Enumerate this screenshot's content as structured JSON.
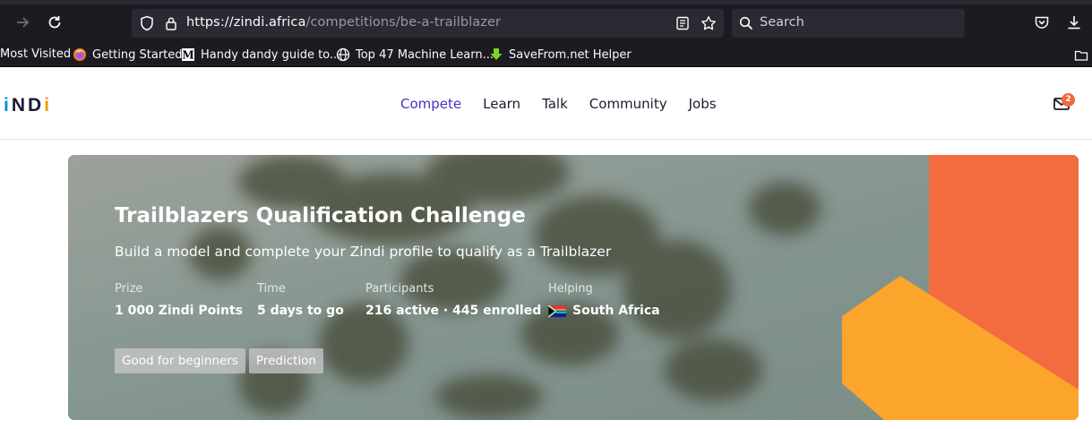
{
  "browser": {
    "url_domain": "https://zindi.africa",
    "url_path": "/competitions/be-a-trailblazer",
    "search_placeholder": "Search",
    "bookmarks": [
      {
        "label": "Most Visited",
        "icon": "none"
      },
      {
        "label": "Getting Started",
        "icon": "firefox-icon"
      },
      {
        "label": "Handy dandy guide to...",
        "icon": "medium-icon"
      },
      {
        "label": "Top 47 Machine Learn...",
        "icon": "globe-icon"
      },
      {
        "label": "SaveFrom.net Helper",
        "icon": "download-arrow-icon"
      }
    ]
  },
  "site": {
    "logo": "iNDi",
    "nav": [
      {
        "label": "Compete",
        "active": true
      },
      {
        "label": "Learn",
        "active": false
      },
      {
        "label": "Talk",
        "active": false
      },
      {
        "label": "Community",
        "active": false
      },
      {
        "label": "Jobs",
        "active": false
      }
    ],
    "mail_count": "2"
  },
  "competition": {
    "title": "Trailblazers Qualification Challenge",
    "subtitle": "Build a model and complete your Zindi profile to qualify as a Trailblazer",
    "stats": [
      {
        "label": "Prize",
        "value": "1 000 Zindi Points"
      },
      {
        "label": "Time",
        "value": "5 days to go"
      },
      {
        "label": "Participants",
        "value": "216 active · 445 enrolled"
      },
      {
        "label": "Helping",
        "value": "South Africa"
      }
    ],
    "tags": [
      "Good for beginners",
      "Prediction"
    ]
  },
  "colors": {
    "accent": "#4a2fc4",
    "orange": "#f26c3f",
    "amber": "#fba52c",
    "badge": "#f06a3a"
  }
}
